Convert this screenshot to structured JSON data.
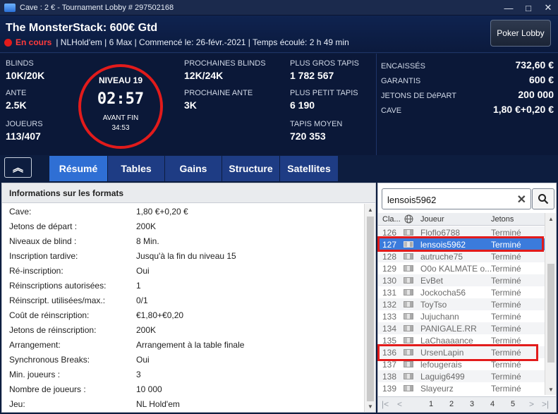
{
  "window": {
    "title": "Cave : 2 € - Tournament Lobby # 297502168",
    "controls": [
      "—",
      "□",
      "✕"
    ]
  },
  "header": {
    "tournament_name": "The MonsterStack: 600€ Gtd",
    "status": "En cours",
    "details": "| NLHold'em | 6 Max | Commencé le: 26-févr.-2021 | Temps écoulé: 2 h  49 min",
    "poker_lobby_button": "Poker Lobby"
  },
  "stats": {
    "blinds_label": "BLINDS",
    "blinds_value": "10K/20K",
    "ante_label": "ANTE",
    "ante_value": "2.5K",
    "players_label": "JOUEURS",
    "players_value": "113/407",
    "next_blinds_label": "PROCHAINES BLINDS",
    "next_blinds_value": "12K/24K",
    "next_ante_label": "PROCHAINE ANTE",
    "next_ante_value": "3K",
    "biggest_stack_label": "PLUS GROS TAPIS",
    "biggest_stack_value": "1 782 567",
    "smallest_stack_label": "PLUS PETIT TAPIS",
    "smallest_stack_value": "6 190",
    "avg_stack_label": "TAPIS MOYEN",
    "avg_stack_value": "720 353"
  },
  "level": {
    "title": "NIVEAU 19",
    "time": "02:57",
    "before_label": "AVANT FIN",
    "before_time": "34:53"
  },
  "prize": {
    "collected_label": "ENCAISSÉS",
    "collected_value": "732,60 €",
    "guaranteed_label": "GARANTIS",
    "guaranteed_value": "600 €",
    "starting_chips_label": "JETONS DE DéPART",
    "starting_chips_value": "200 000",
    "buyin_label": "CAVE",
    "buyin_value": "1,80 €+0,20 €"
  },
  "tabs": {
    "collapse_glyph": "︽",
    "items": [
      "Résumé",
      "Tables",
      "Gains",
      "Structure",
      "Satellites"
    ],
    "active": "Résumé"
  },
  "formats": {
    "title": "Informations sur les formats",
    "rows": [
      {
        "k": "Cave:",
        "v": "1,80 €+0,20 €"
      },
      {
        "k": "Jetons de départ :",
        "v": "200K"
      },
      {
        "k": "Niveaux de blind :",
        "v": "8 Min."
      },
      {
        "k": "Inscription tardive:",
        "v": "Jusqu'à la fin du niveau 15"
      },
      {
        "k": "Ré-inscription:",
        "v": "Oui"
      },
      {
        "k": "Réinscriptions autorisées:",
        "v": "1"
      },
      {
        "k": "Réinscript. utilisées/max.:",
        "v": "0/1"
      },
      {
        "k": "Coût de réinscription:",
        "v": "€1,80+€0,20"
      },
      {
        "k": "Jetons de réinscription:",
        "v": "200K"
      },
      {
        "k": "Arrangement:",
        "v": "Arrangement à la table finale"
      },
      {
        "k": "Synchronous Breaks:",
        "v": "Oui"
      },
      {
        "k": "Min. joueurs :",
        "v": "3"
      },
      {
        "k": "Nombre de joueurs :",
        "v": "10 000"
      },
      {
        "k": "Jeu:",
        "v": "NL Hold'em"
      }
    ]
  },
  "players": {
    "search_value": "lensois5962",
    "columns": {
      "rank": "Cla...",
      "player": "Joueur",
      "chips": "Jetons"
    },
    "rows": [
      {
        "rank": "126",
        "name": "Floflo6788",
        "status": "Terminé"
      },
      {
        "rank": "127",
        "name": "lensois5962",
        "status": "Terminé",
        "selected": true
      },
      {
        "rank": "128",
        "name": "autruche75",
        "status": "Terminé"
      },
      {
        "rank": "129",
        "name": "O0o KALMATE o...",
        "status": "Terminé"
      },
      {
        "rank": "130",
        "name": "EvBet",
        "status": "Terminé"
      },
      {
        "rank": "131",
        "name": "Jockocha56",
        "status": "Terminé"
      },
      {
        "rank": "132",
        "name": "ToyTso",
        "status": "Terminé"
      },
      {
        "rank": "133",
        "name": "Jujuchann",
        "status": "Terminé"
      },
      {
        "rank": "134",
        "name": "PANIGALE.RR",
        "status": "Terminé"
      },
      {
        "rank": "135",
        "name": "LaChaaaance",
        "status": "Terminé"
      },
      {
        "rank": "136",
        "name": "UrsenLapin",
        "status": "Terminé"
      },
      {
        "rank": "137",
        "name": "lefougerais",
        "status": "Terminé"
      },
      {
        "rank": "138",
        "name": "Laguig6499",
        "status": "Terminé"
      },
      {
        "rank": "139",
        "name": "Slayeurz",
        "status": "Terminé"
      }
    ],
    "pager": {
      "first": "|<",
      "prev": "<",
      "pages": [
        "1",
        "2",
        "3",
        "4",
        "5"
      ],
      "next": ">",
      "last": ">|"
    }
  },
  "colors": {
    "accent": "#2f6fd4",
    "live_red": "#e21b1b",
    "bg": "#0d1d3f"
  },
  "icons": [
    "app-icon",
    "minimize-icon",
    "maximize-icon",
    "close-icon",
    "live-dot-icon",
    "collapse-chevrons-icon",
    "clear-search-icon",
    "search-icon",
    "globe-icon",
    "flag-icon"
  ]
}
